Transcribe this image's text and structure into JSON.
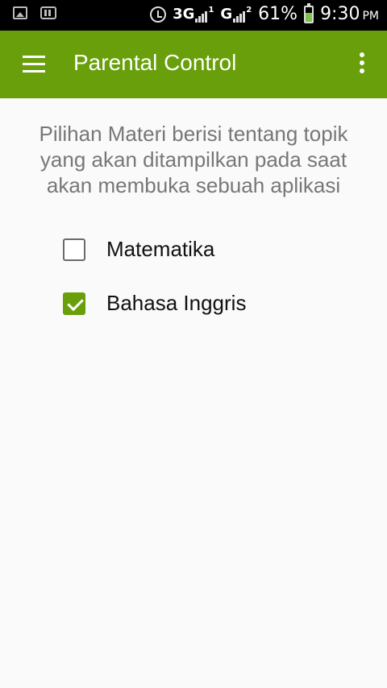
{
  "status_bar": {
    "network_1": "3G",
    "sim_1": "1",
    "network_2": "G",
    "sim_2": "2",
    "battery_text": "61%",
    "battery_level": 0.61,
    "time": "9:30",
    "ampm": "PM"
  },
  "app_bar": {
    "title": "Parental Control",
    "color": "#689f0a"
  },
  "description": "Pilihan Materi berisi tentang topik yang akan ditampilkan pada saat akan membuka sebuah aplikasi",
  "options": [
    {
      "label": "Matematika",
      "checked": false
    },
    {
      "label": "Bahasa Inggris",
      "checked": true
    }
  ]
}
